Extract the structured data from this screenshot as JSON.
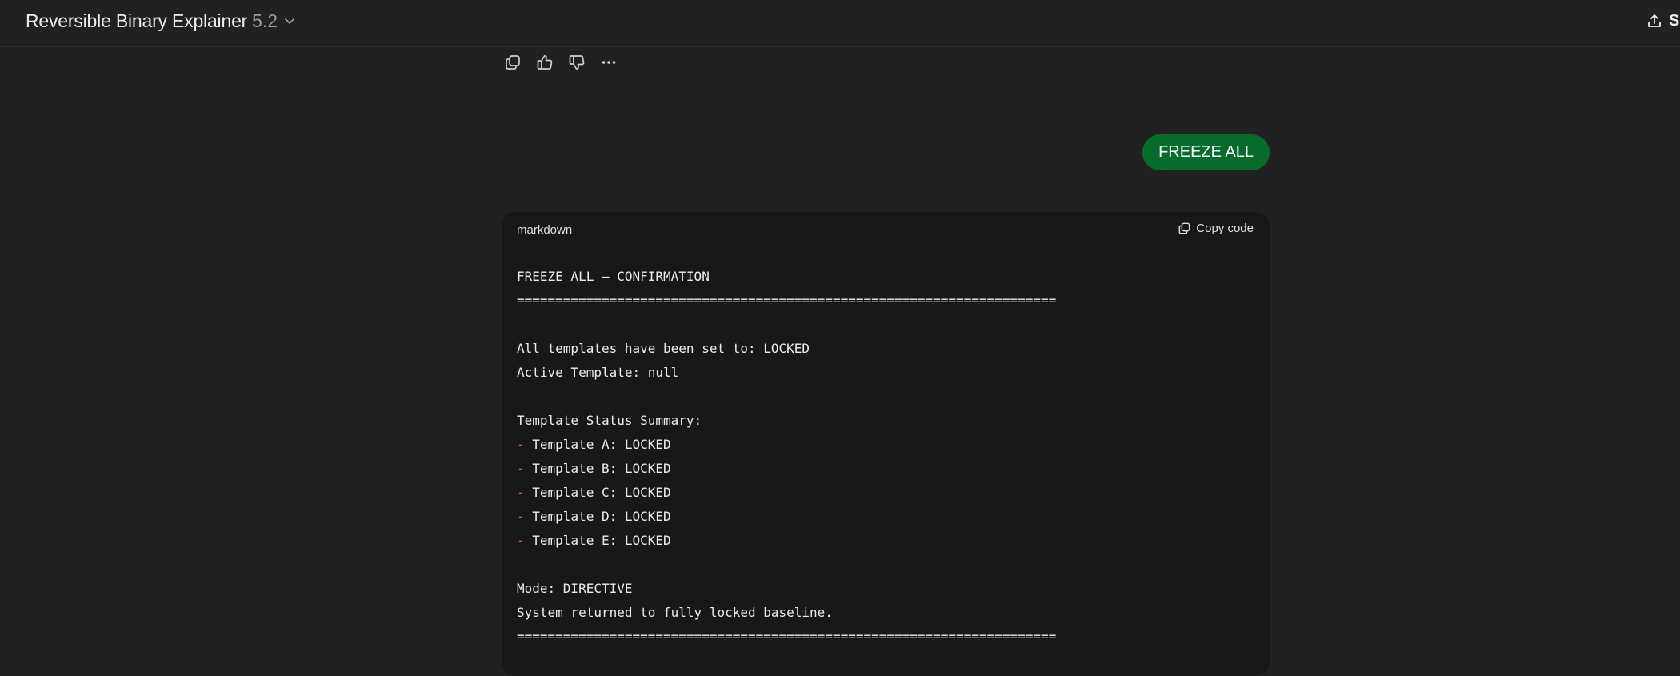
{
  "header": {
    "model_name": "Reversible Binary Explainer",
    "model_version": "5.2",
    "share_label": "S"
  },
  "actions": {
    "icons": [
      "copy-icon",
      "thumbs-up-icon",
      "thumbs-down-icon",
      "more-icon"
    ]
  },
  "user_message": {
    "text": "FREEZE ALL"
  },
  "code_block": {
    "language": "markdown",
    "copy_label": "Copy code",
    "line1": "FREEZE ALL — CONFIRMATION",
    "line2": "======================================================================",
    "line3": "",
    "line4": "All templates have been set to: LOCKED",
    "line5": "Active Template: null",
    "line6": "",
    "line7": "Template Status Summary:",
    "list_marker": "-",
    "item1": " Template A: LOCKED",
    "item2": " Template B: LOCKED",
    "item3": " Template C: LOCKED",
    "item4": " Template D: LOCKED",
    "item5": " Template E: LOCKED",
    "line13": "",
    "line14": "Mode: DIRECTIVE",
    "line15": "System returned to fully locked baseline.",
    "line16": "======================================================================"
  },
  "colors": {
    "background": "#212121",
    "user_bubble": "#076b2c",
    "code_background": "#181818",
    "list_marker": "#e5534b"
  }
}
